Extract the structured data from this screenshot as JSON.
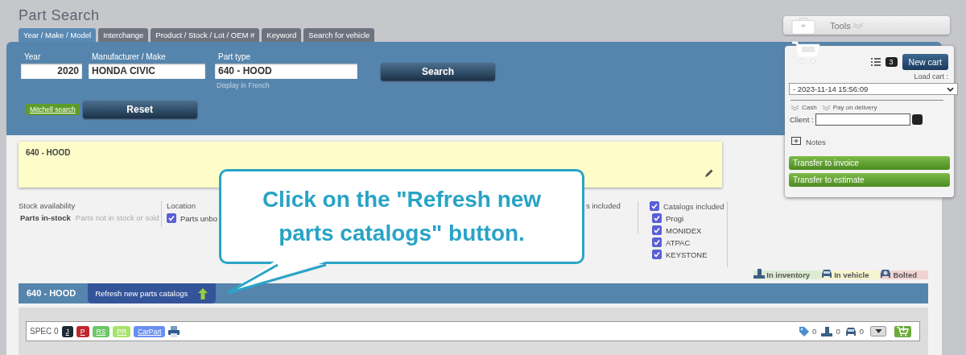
{
  "title": "Part Search",
  "tabs": [
    {
      "label": "Year / Make / Model",
      "selected": true
    },
    {
      "label": "Interchange",
      "selected": false
    },
    {
      "label": "Product / Stock / Lot / OEM #",
      "selected": false
    },
    {
      "label": "Keyword",
      "selected": false
    },
    {
      "label": "Search for vehicle",
      "selected": false
    }
  ],
  "search_form": {
    "year": {
      "label": "Year",
      "value": "2020"
    },
    "make": {
      "label": "Manufacturer / Make",
      "value": "HONDA CIVIC"
    },
    "part_type": {
      "label": "Part type",
      "value": "640 - HOOD",
      "note": "Display in French"
    },
    "search_button": "Search",
    "mitchell_link": "Mitchell search",
    "reset_button": "Reset"
  },
  "selected_part": "640 - HOOD",
  "filters": {
    "stock": {
      "label": "Stock availability",
      "options": [
        {
          "label": "Parts in-stock",
          "selected": true
        },
        {
          "label": "Parts not in stock or sold",
          "selected": false
        }
      ]
    },
    "location": {
      "label": "Location",
      "options": [
        {
          "label": "Parts unbo",
          "checked": true
        }
      ]
    },
    "partial_label": "s included",
    "catalogs": {
      "label": "Catalogs included",
      "checked": true,
      "items": [
        {
          "label": "Progi",
          "checked": true
        },
        {
          "label": "MONIDEX",
          "checked": true
        },
        {
          "label": "ATPAC",
          "checked": true
        },
        {
          "label": "KEYSTONE",
          "checked": true
        }
      ]
    }
  },
  "legend": [
    {
      "kind": "inventory",
      "label": "In inventory",
      "color": "#dcebd2"
    },
    {
      "kind": "vehicle",
      "label": "In vehicle",
      "color": "#f6f3cf"
    },
    {
      "kind": "bolted",
      "label": "Bolted",
      "color": "#f2d3d3"
    }
  ],
  "result": {
    "title": "640 - HOOD",
    "refresh_button": "Refresh new parts catalogs",
    "spec": "SPEC 0",
    "badges": [
      {
        "label": "J",
        "color": "#1c2a35"
      },
      {
        "label": "P",
        "color": "#c0272d"
      },
      {
        "label": "RS",
        "color": "#6cc765"
      },
      {
        "label": "PR",
        "color": "#a8e36a"
      },
      {
        "label": "CarPart",
        "color": "#6b8ff0"
      }
    ],
    "counts": [
      {
        "kind": "tag",
        "value": "0"
      },
      {
        "kind": "inventory",
        "value": "0"
      },
      {
        "kind": "vehicle",
        "value": "0"
      }
    ]
  },
  "tools": {
    "label": "Tools"
  },
  "cart": {
    "count": "3",
    "new_cart": "New cart",
    "load_label": "Load cart :",
    "loaded": "- 2023-11-14 15:56:09",
    "payment": [
      "Cash",
      "Pay on delivery"
    ],
    "client_label": "Client :",
    "notes": "Notes",
    "actions": [
      "Transfer to invoice",
      "Transfer to estimate"
    ]
  },
  "callout": {
    "text": "Click on the \"Refresh new parts catalogs\" button."
  }
}
